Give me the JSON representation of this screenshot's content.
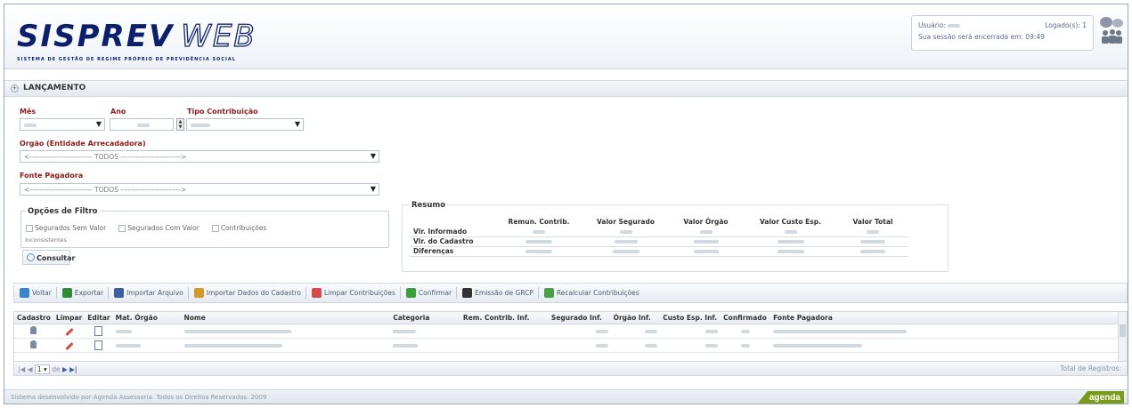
{
  "header": {
    "logo_main": "SISPREV",
    "logo_web": "WEB",
    "logo_sub": "SISTEMA DE GESTÃO DE REGIME PRÓPRIO DE PREVIDÊNCIA SOCIAL",
    "session": {
      "user_label": "Usuário: ",
      "logged_label": "Logado(s): 1",
      "expire_label": "Sua sessão será encerrada em: 09:49"
    }
  },
  "section": {
    "title": "LANÇAMENTO",
    "toggle": "+"
  },
  "form": {
    "mes_label": "Mês",
    "ano_label": "Ano",
    "tipo_label": "Tipo Contribuição",
    "orgao_label": "Orgão (Entidade Arrecadadora)",
    "orgao_value": "<-------------------------- TODOS ------------------------->",
    "fonte_label": "Fonte Pagadora",
    "fonte_value": "<-------------------------- TODOS ------------------------->",
    "filter_legend": "Opções de Filtro",
    "filter_options": [
      "Segurados Sem Valor",
      "Segurados Com Valor",
      "Contribuições"
    ],
    "filter_extra": "Inconsistentes",
    "consultar_label": "Consultar"
  },
  "resumo": {
    "legend": "Resumo",
    "columns": [
      "Remun. Contrib.",
      "Valor Segurado",
      "Valor Órgão",
      "Valor Custo Esp.",
      "Valor Total"
    ],
    "rows": [
      "Vlr. Informado",
      "Vlr. do Cadastro",
      "Diferenças"
    ]
  },
  "toolbar": {
    "items": [
      {
        "label": "Voltar",
        "icon": "back-icon",
        "color": "#3a86c8"
      },
      {
        "label": "Exportar",
        "icon": "excel-icon",
        "color": "#2e8b3a"
      },
      {
        "label": "Importar Arquivo",
        "icon": "import-file-icon",
        "color": "#3a5fa0"
      },
      {
        "label": "Importar Dados do Cadastro",
        "icon": "import-data-icon",
        "color": "#d19a2a"
      },
      {
        "label": "Limpar Contribuições",
        "icon": "eraser-icon",
        "color": "#d34b4b"
      },
      {
        "label": "Confirmar",
        "icon": "check-icon",
        "color": "#3aa03a"
      },
      {
        "label": "Emissão de GRCP",
        "icon": "barcode-icon",
        "color": "#333333"
      },
      {
        "label": "Recalcular Contribuições",
        "icon": "calc-icon",
        "color": "#4aa04a"
      }
    ]
  },
  "grid": {
    "columns": [
      "Cadastro",
      "Limpar",
      "Editar",
      "Mat. Órgão",
      "Nome",
      "Categoria",
      "Rem. Contrib. Inf.",
      "Segurado Inf.",
      "Órgão Inf.",
      "Custo Esp. Inf.",
      "Confirmado",
      "Fonte Pagadora"
    ]
  },
  "pager": {
    "first": "|◀",
    "prev": "◀",
    "page": "1",
    "of_label": "de",
    "next": "▶",
    "last": "▶|",
    "total_label": "Total de Registros:"
  },
  "footer": {
    "text": "Sistema desenvolvido por Agenda Assessoria. Todos os Direitos Reservados. 2009",
    "brand": "agenda"
  }
}
